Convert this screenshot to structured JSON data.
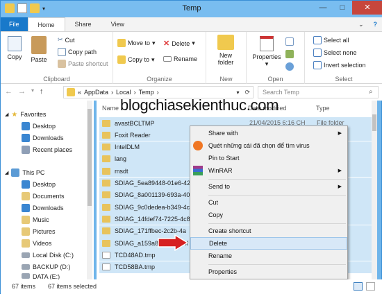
{
  "window": {
    "title": "Temp"
  },
  "tabs": [
    "File",
    "Home",
    "Share",
    "View"
  ],
  "ribbon": {
    "clipboard": {
      "copy": "Copy",
      "paste": "Paste",
      "cut": "Cut",
      "copy_path": "Copy path",
      "paste_shortcut": "Paste shortcut",
      "label": "Clipboard"
    },
    "organize": {
      "move_to": "Move to",
      "copy_to": "Copy to",
      "delete": "Delete",
      "rename": "Rename",
      "label": "Organize"
    },
    "new": {
      "new_folder_line1": "New",
      "new_folder_line2": "folder",
      "label": "New"
    },
    "open": {
      "properties": "Properties",
      "label": "Open"
    },
    "select": {
      "select_all": "Select all",
      "select_none": "Select none",
      "invert": "Invert selection",
      "label": "Select"
    }
  },
  "address": {
    "prefix": "«",
    "crumbs": [
      "AppData",
      "Local",
      "Temp"
    ],
    "search_placeholder": "Search Temp"
  },
  "nav_pane": {
    "items": [
      {
        "label": "Favorites",
        "icon": "star-icon"
      },
      {
        "label": "Desktop",
        "icon": "desktop-icon"
      },
      {
        "label": "Downloads",
        "icon": "downloads-icon"
      },
      {
        "label": "Recent places",
        "icon": "recent-places-icon"
      },
      {
        "label": "This PC",
        "icon": "computer-icon"
      },
      {
        "label": "Desktop",
        "icon": "desktop-icon"
      },
      {
        "label": "Documents",
        "icon": "documents-icon"
      },
      {
        "label": "Downloads",
        "icon": "downloads-icon"
      },
      {
        "label": "Music",
        "icon": "music-icon"
      },
      {
        "label": "Pictures",
        "icon": "pictures-icon"
      },
      {
        "label": "Videos",
        "icon": "videos-icon"
      },
      {
        "label": "Local Disk (C:)",
        "icon": "disk-icon"
      },
      {
        "label": "BACKUP (D:)",
        "icon": "disk-icon"
      },
      {
        "label": "DATA (E:)",
        "icon": "disk-icon"
      }
    ]
  },
  "columns": {
    "name": "Name",
    "date": "Date modified",
    "type": "Type"
  },
  "first_row": {
    "date": "21/04/2015 6:16 CH",
    "type": "File folder"
  },
  "files": [
    "avastBCLTMP",
    "Foxit Reader",
    "IntelDLM",
    "lang",
    "msdt",
    "SDIAG_5ea89448-01e6-42",
    "SDIAG_8a001139-693a-40",
    "SDIAG_9c0dedea-b349-4c",
    "SDIAG_14fdef74-7225-4c8",
    "SDIAG_171ffbec-2c2b-4a",
    "SDIAG_a159a8ce-8d04-4f",
    "TCD48AD.tmp",
    "TCD58BA.tmp"
  ],
  "watermark": "blogchiasekienthuc.com",
  "context_menu": {
    "items": [
      {
        "label": "Share with",
        "submenu": true
      },
      {
        "label": "Quét những cái đã chọn để tìm virus",
        "icon": "avast-icon"
      },
      {
        "label": "Pin to Start"
      },
      {
        "label": "WinRAR",
        "submenu": true,
        "icon": "winrar-icon"
      },
      {
        "label": "Send to",
        "submenu": true
      },
      {
        "label": "Cut"
      },
      {
        "label": "Copy"
      },
      {
        "label": "Create shortcut"
      },
      {
        "label": "Delete",
        "highlight": true
      },
      {
        "label": "Rename"
      },
      {
        "label": "Properties"
      }
    ]
  },
  "status": {
    "count": "67 items",
    "selected": "67 items selected"
  }
}
